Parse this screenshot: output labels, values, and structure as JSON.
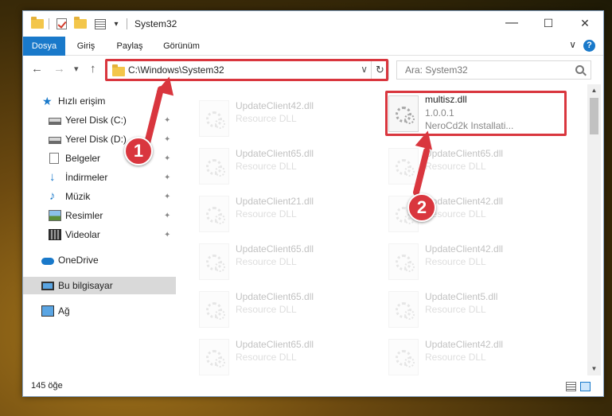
{
  "window": {
    "title": "System32",
    "controls": {
      "minimize": "—",
      "maximize": "☐",
      "close": "✕"
    }
  },
  "ribbon": {
    "tabs": [
      {
        "label": "Dosya",
        "active": true
      },
      {
        "label": "Giriş",
        "active": false
      },
      {
        "label": "Paylaş",
        "active": false
      },
      {
        "label": "Görünüm",
        "active": false
      }
    ],
    "collapse_glyph": "∨",
    "help_glyph": "?"
  },
  "nav": {
    "back_glyph": "←",
    "forward_glyph": "→",
    "recent_glyph": "▾",
    "up_glyph": "↑",
    "address": "C:\\Windows\\System32",
    "address_dropdown_glyph": "∨",
    "refresh_glyph": "↻",
    "search_placeholder": "Ara: System32"
  },
  "sidebar": {
    "items": [
      {
        "label": "Hızlı erişim",
        "icon": "star-icon",
        "pinned": false
      },
      {
        "label": "Yerel Disk (C:)",
        "icon": "drive-icon",
        "pinned": true
      },
      {
        "label": "Yerel Disk (D:)",
        "icon": "drive-icon",
        "pinned": true
      },
      {
        "label": "Belgeler",
        "icon": "document-icon",
        "pinned": true
      },
      {
        "label": "İndirmeler",
        "icon": "download-icon",
        "pinned": true
      },
      {
        "label": "Müzik",
        "icon": "music-icon",
        "pinned": true
      },
      {
        "label": "Resimler",
        "icon": "pictures-icon",
        "pinned": true
      },
      {
        "label": "Videolar",
        "icon": "video-icon",
        "pinned": true
      },
      {
        "label": "OneDrive",
        "icon": "cloud-icon",
        "pinned": false
      },
      {
        "label": "Bu bilgisayar",
        "icon": "computer-icon",
        "pinned": false,
        "selected": true
      },
      {
        "label": "Ağ",
        "icon": "network-icon",
        "pinned": false
      }
    ],
    "pin_glyph": "📌"
  },
  "files": {
    "left_column": [
      {
        "name": "UpdateClient42.dll",
        "desc": "Resource DLL"
      },
      {
        "name": "UpdateClient65.dll",
        "desc": "Resource DLL"
      },
      {
        "name": "UpdateClient21.dll",
        "desc": "Resource DLL"
      },
      {
        "name": "UpdateClient65.dll",
        "desc": "Resource DLL"
      },
      {
        "name": "UpdateClient65.dll",
        "desc": "Resource DLL"
      },
      {
        "name": "UpdateClient65.dll",
        "desc": "Resource DLL"
      }
    ],
    "right_column": [
      {
        "name": "multisz.dll",
        "version": "1.0.0.1",
        "desc": "NeroCd2k Installati...",
        "highlighted": true
      },
      {
        "name": "UpdateClient65.dll",
        "desc": "Resource DLL"
      },
      {
        "name": "UpdateClient42.dll",
        "desc": "Resource DLL"
      },
      {
        "name": "UpdateClient42.dll",
        "desc": "Resource DLL"
      },
      {
        "name": "UpdateClient5.dll",
        "desc": "Resource DLL"
      },
      {
        "name": "UpdateClient42.dll",
        "desc": "Resource DLL"
      }
    ]
  },
  "status": {
    "item_count": "145 öğe"
  },
  "annotations": {
    "badge1": "1",
    "badge2": "2",
    "color": "#d9363e"
  },
  "scroll": {
    "up": "▲",
    "down": "▼"
  }
}
